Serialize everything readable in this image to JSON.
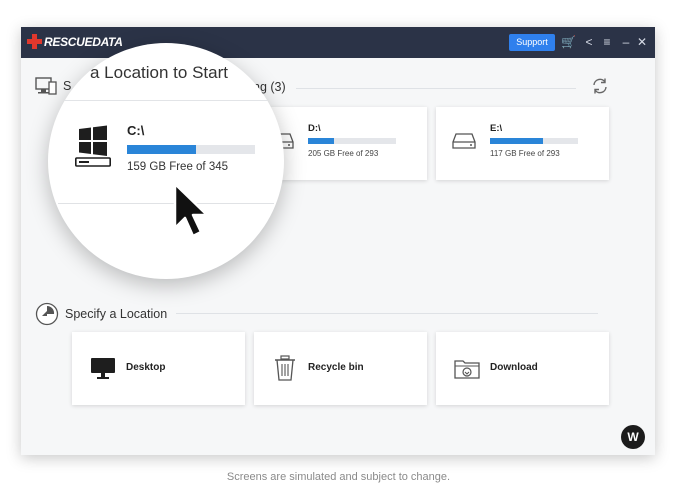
{
  "app": {
    "logo_text": "RESCUEDATA"
  },
  "titlebar": {
    "support_label": "Support",
    "icons": [
      "cart-icon",
      "share-icon",
      "menu-icon",
      "minimize-icon",
      "close-icon"
    ],
    "cart_glyph": "🛒",
    "share_glyph": "<",
    "menu_glyph": "≡",
    "min_glyph": "–",
    "close_glyph": "✕"
  },
  "drives_section": {
    "title_visible": "S",
    "title_tail": "ng (3)",
    "drives": [
      {
        "name": "C:\\",
        "free_text": "159 GB Free of 345",
        "free_fraction": 0.54
      },
      {
        "name": "D:\\",
        "free_text": "205 GB Free of 293",
        "free_fraction": 0.3
      },
      {
        "name": "E:\\",
        "free_text": "117 GB Free of 293",
        "free_fraction": 0.6
      }
    ]
  },
  "location_section": {
    "title": "Specify a Location",
    "items": [
      {
        "label": "Desktop",
        "icon": "monitor-icon"
      },
      {
        "label": "Recycle bin",
        "icon": "trash-icon"
      },
      {
        "label": "Download",
        "icon": "download-folder-icon"
      }
    ]
  },
  "magnifier": {
    "title": "a Location to Start",
    "drive_name": "C:\\",
    "free_text": "159 GB Free of 345",
    "free_fraction": 0.54
  },
  "fab_glyph": "W",
  "caption": "Screens are simulated and subject to change.",
  "colors": {
    "titlebar": "#2b3347",
    "accent": "#2f80ed",
    "bar_fill": "#2a85d8",
    "logo_red": "#e0382d"
  }
}
